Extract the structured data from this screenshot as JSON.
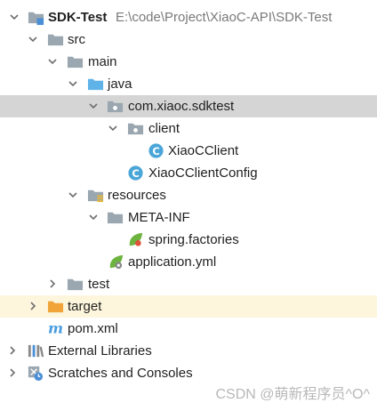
{
  "project": {
    "name": "SDK-Test",
    "path": "E:\\code\\Project\\XiaoC-API\\SDK-Test"
  },
  "tree": [
    {
      "label": "src",
      "icon": "folder-icon"
    },
    {
      "label": "main",
      "icon": "folder-icon"
    },
    {
      "label": "java",
      "icon": "source-folder-icon"
    },
    {
      "label": "com.xiaoc.sdktest",
      "icon": "package-icon"
    },
    {
      "label": "client",
      "icon": "package-icon"
    },
    {
      "label": "XiaoCClient",
      "icon": "class-icon"
    },
    {
      "label": "XiaoCClientConfig",
      "icon": "class-icon"
    },
    {
      "label": "resources",
      "icon": "resources-folder-icon"
    },
    {
      "label": "META-INF",
      "icon": "folder-icon"
    },
    {
      "label": "spring.factories",
      "icon": "spring-icon"
    },
    {
      "label": "application.yml",
      "icon": "spring-config-icon"
    },
    {
      "label": "test",
      "icon": "folder-icon"
    },
    {
      "label": "target",
      "icon": "excluded-folder-icon"
    },
    {
      "label": "pom.xml",
      "icon": "maven-icon"
    },
    {
      "label": "External Libraries",
      "icon": "libraries-icon"
    },
    {
      "label": "Scratches and Consoles",
      "icon": "scratches-icon"
    }
  ],
  "watermark": "CSDN @萌新程序员^O^",
  "colors": {
    "selection": "#d5d5d5",
    "excluded_row": "#fdf6dc",
    "folder": "#9aa7b0",
    "source_folder": "#5fb3e8",
    "excluded_folder": "#f0a43a",
    "class_icon": "#4aa6d8",
    "spring": "#6db33f",
    "maven": "#4a9de0"
  }
}
